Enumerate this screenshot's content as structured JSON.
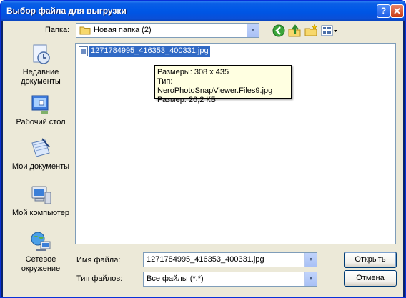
{
  "window": {
    "title": "Выбор файла для выгрузки",
    "help_glyph": "?",
    "close_glyph": "✕"
  },
  "toolbar": {
    "folder_label": "Папка:",
    "folder_value": "Новая папка (2)",
    "icons": [
      "back-icon",
      "up-folder-icon",
      "new-folder-icon",
      "view-menu-icon"
    ]
  },
  "places": [
    {
      "icon": "recent-documents-icon",
      "label": "Недавние документы"
    },
    {
      "icon": "desktop-icon",
      "label": "Рабочий стол"
    },
    {
      "icon": "my-documents-icon",
      "label": "Мои документы"
    },
    {
      "icon": "my-computer-icon",
      "label": "Мой компьютер"
    },
    {
      "icon": "network-places-icon",
      "label": "Сетевое окружение"
    }
  ],
  "files": [
    {
      "name": "1271784995_416353_400331.jpg",
      "selected": true
    }
  ],
  "tooltip": {
    "line1": "Размеры: 308 x 435",
    "line2": "Тип: NeroPhotoSnapViewer.Files9.jpg",
    "line3": "Размер: 26,2 КБ"
  },
  "filename": {
    "label": "Имя файла:",
    "value": "1271784995_416353_400331.jpg"
  },
  "filetype": {
    "label": "Тип файлов:",
    "value": "Все файлы (*.*)"
  },
  "buttons": {
    "open": "Открыть",
    "cancel": "Отмена"
  },
  "colors": {
    "titlebar": "#0054e3",
    "selection": "#316ac5",
    "dialog_bg": "#ece9d8",
    "tooltip_bg": "#ffffe1"
  }
}
